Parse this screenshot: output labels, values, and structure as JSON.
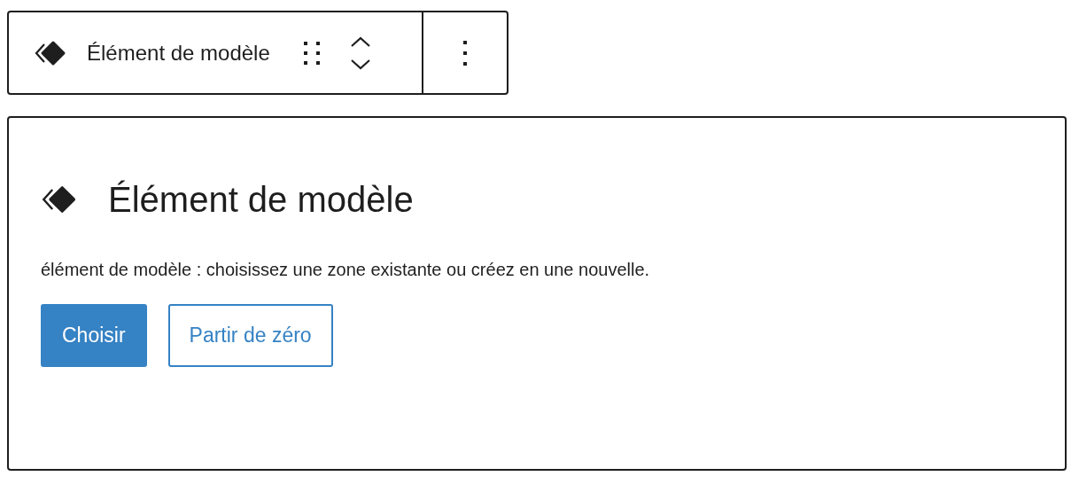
{
  "toolbar": {
    "block_label": "Élément de modèle"
  },
  "placeholder": {
    "title": "Élément de modèle",
    "instructions": "élément de modèle : choisissez une zone existante ou créez en une nouvelle.",
    "buttons": [
      {
        "label": "Choisir",
        "kind": "primary"
      },
      {
        "label": "Partir de zéro",
        "kind": "secondary"
      }
    ]
  }
}
